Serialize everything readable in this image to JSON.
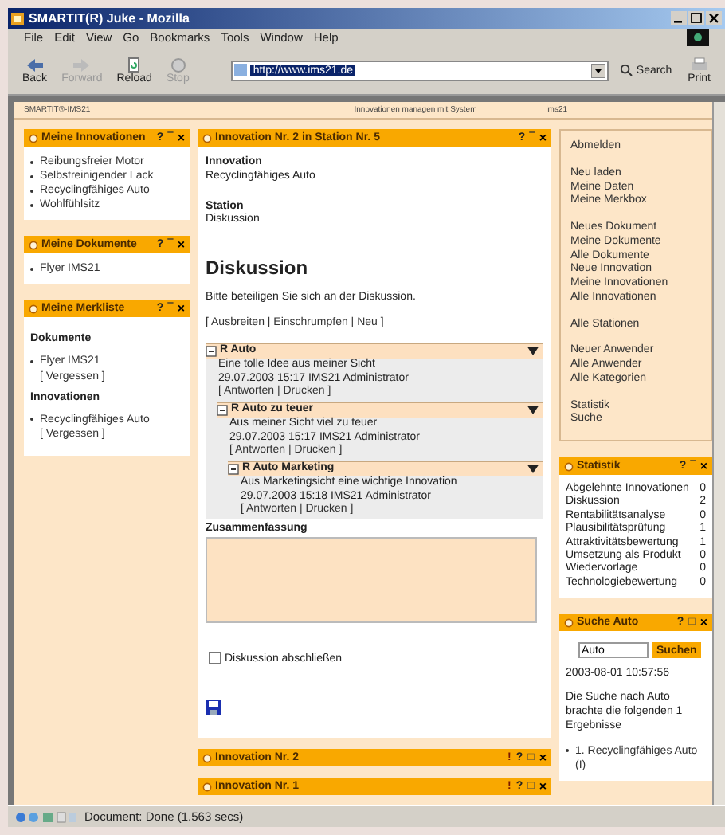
{
  "window": {
    "title": "SMARTIT(R) Juke - Mozilla"
  },
  "menu": [
    "File",
    "Edit",
    "View",
    "Go",
    "Bookmarks",
    "Tools",
    "Window",
    "Help"
  ],
  "toolbar": {
    "buttons": [
      {
        "kind": "back",
        "label": "Back",
        "disabled": false
      },
      {
        "kind": "forward",
        "label": "Forward",
        "disabled": true
      },
      {
        "kind": "reload",
        "label": "Reload",
        "disabled": false
      },
      {
        "kind": "stop",
        "label": "Stop",
        "disabled": true
      }
    ],
    "address": "http://www.ims21.de",
    "search_label": "Search",
    "print_label": "Print"
  },
  "page_header": {
    "left": "SMARTIT®-IMS21",
    "center": "Innovationen managen mit System",
    "right": "ims21"
  },
  "left_panels": [
    {
      "title": "Meine Innovationen",
      "controls": [
        {
          "kind": "help",
          "label": "?"
        },
        {
          "kind": "minimize",
          "label": "‾"
        },
        {
          "kind": "close",
          "label": "×"
        }
      ],
      "items": [
        "Reibungsfreier Motor",
        "Selbstreinigender Lack",
        "Recyclingfähiges Auto",
        "Wohlfühlsitz"
      ]
    },
    {
      "title": "Meine Dokumente",
      "controls": [
        {
          "kind": "help",
          "label": "?"
        },
        {
          "kind": "minimize",
          "label": "‾"
        },
        {
          "kind": "close",
          "label": "×"
        }
      ],
      "items": [
        "Flyer IMS21"
      ]
    },
    {
      "title": "Meine Merkliste",
      "controls": [
        {
          "kind": "help",
          "label": "?"
        },
        {
          "kind": "minimize",
          "label": "‾"
        },
        {
          "kind": "close",
          "label": "×"
        }
      ],
      "groups": [
        {
          "heading": "Dokumente",
          "items": [
            {
              "name": "Flyer IMS21",
              "action": "[ Vergessen ]"
            }
          ]
        },
        {
          "heading": "Innovationen",
          "items": [
            {
              "name": "Recyclingfähiges Auto",
              "action": "[ Vergessen ]"
            }
          ]
        }
      ]
    }
  ],
  "main": {
    "title": "Innovation Nr. 2 in Station Nr. 5",
    "controls": [
      {
        "kind": "help",
        "label": "?"
      },
      {
        "kind": "minimize",
        "label": "‾"
      },
      {
        "kind": "close",
        "label": "×"
      }
    ],
    "fields": [
      {
        "label": "Innovation",
        "value": "Recyclingfähiges Auto"
      },
      {
        "label": "Station",
        "value": "Diskussion"
      }
    ],
    "heading": "Diskussion",
    "intro": "Bitte beteiligen Sie sich an der Diskussion.",
    "actions": "[ Ausbreiten | Einschrumpfen | Neu ]",
    "thread": [
      {
        "title": "R Auto",
        "text": "Eine tolle Idee aus meiner Sicht",
        "meta": "29.07.2003 15:17 IMS21 Administrator",
        "actions": "[ Antworten | Drucken ]",
        "children": [
          {
            "title": "R Auto zu teuer",
            "text": "Aus meiner Sicht viel zu teuer",
            "meta": "29.07.2003 15:17 IMS21 Administrator",
            "actions": "[ Antworten | Drucken ]",
            "children": [
              {
                "title": "R Auto Marketing",
                "text": "Aus Marketingsicht eine wichtige Innovation",
                "meta": "29.07.2003 15:18 IMS21 Administrator",
                "actions": "[ Antworten | Drucken ]"
              }
            ]
          }
        ]
      }
    ],
    "summary_label": "Zusammenfassung",
    "closing_checkbox": {
      "label": "Diskussion abschließen",
      "checked": false
    }
  },
  "collapsed_panels": [
    {
      "title": "Innovation Nr. 2",
      "controls": [
        {
          "kind": "alert",
          "label": "!"
        },
        {
          "kind": "help",
          "label": "?"
        },
        {
          "kind": "maximize",
          "label": "□"
        },
        {
          "kind": "close",
          "label": "×"
        }
      ]
    },
    {
      "title": "Innovation Nr. 1",
      "controls": [
        {
          "kind": "alert",
          "label": "!"
        },
        {
          "kind": "help",
          "label": "?"
        },
        {
          "kind": "maximize",
          "label": "□"
        },
        {
          "kind": "close",
          "label": "×"
        }
      ]
    }
  ],
  "nav_groups": [
    [
      "Abmelden"
    ],
    [
      "Neu laden",
      "Meine Daten",
      "Meine Merkbox"
    ],
    [
      "Neues Dokument",
      "Meine Dokumente",
      "Alle Dokumente",
      "Neue Innovation",
      "Meine Innovationen",
      "Alle Innovationen"
    ],
    [
      "Alle Stationen"
    ],
    [
      "Neuer Anwender",
      "Alle Anwender",
      "Alle Kategorien"
    ],
    [
      "Statistik",
      "Suche"
    ]
  ],
  "statistics": {
    "title": "Statistik",
    "controls": [
      {
        "kind": "help",
        "label": "?"
      },
      {
        "kind": "minimize",
        "label": "‾"
      },
      {
        "kind": "close",
        "label": "×"
      }
    ],
    "rows": [
      {
        "label": "Abgelehnte Innovationen",
        "value": "0"
      },
      {
        "label": "Diskussion",
        "value": "2"
      },
      {
        "label": "Rentabilitätsanalyse",
        "value": "0"
      },
      {
        "label": "Plausibilitätsprüfung",
        "value": "1"
      },
      {
        "label": "Attraktivitätsbewertung",
        "value": "1"
      },
      {
        "label": "Umsetzung als Produkt",
        "value": "0"
      },
      {
        "label": "Wiedervorlage",
        "value": "0"
      },
      {
        "label": "Technologiebewertung",
        "value": "0"
      }
    ]
  },
  "search": {
    "title": "Suche Auto",
    "controls": [
      {
        "kind": "help",
        "label": "?"
      },
      {
        "kind": "maximize",
        "label": "□"
      },
      {
        "kind": "close",
        "label": "×"
      }
    ],
    "value": "Auto",
    "button": "Suchen",
    "timestamp": "2003-08-01 10:57:56",
    "result_text": "Die Suche nach Auto brachte die folgenden 1 Ergebnisse",
    "results": [
      "1. Recyclingfähiges Auto (I)"
    ]
  },
  "status_bar": "Document: Done (1.563 secs)"
}
